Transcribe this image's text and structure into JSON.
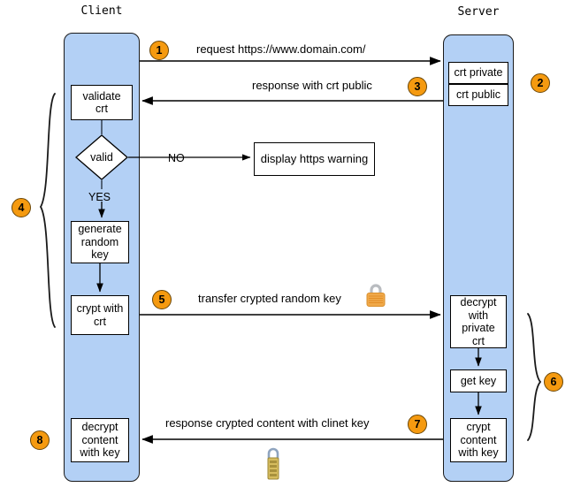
{
  "diagram": {
    "title_client": "Client",
    "title_server": "Server"
  },
  "client": {
    "steps": [
      {
        "id": "validate-crt",
        "label": "validate\ncrt"
      },
      {
        "id": "valid-decision",
        "label": "valid"
      },
      {
        "id": "generate-random-key",
        "label": "generate\nrandom\nkey"
      },
      {
        "id": "crypt-with-crt",
        "label": "crypt with\ncrt"
      },
      {
        "id": "decrypt-content-with-key",
        "label": "decrypt\ncontent\nwith key"
      }
    ],
    "yes_label": "YES",
    "no_label": "NO",
    "warning_box": "display https warning"
  },
  "server": {
    "certs": [
      {
        "id": "crt-private",
        "label": "crt private"
      },
      {
        "id": "crt-public",
        "label": "crt public"
      }
    ],
    "steps": [
      {
        "id": "decrypt-with-private-crt",
        "label": "decrypt\nwith\nprivate\ncrt"
      },
      {
        "id": "get-key",
        "label": "get key"
      },
      {
        "id": "crypt-content-with-key",
        "label": "crypt\ncontent\nwith key"
      }
    ]
  },
  "messages": [
    {
      "id": "m1",
      "label": "request https://www.domain.com/"
    },
    {
      "id": "m3",
      "label": "response with crt public"
    },
    {
      "id": "m5",
      "label": "transfer crypted random key"
    },
    {
      "id": "m7",
      "label": "response crypted content with clinet key"
    }
  ],
  "markers": [
    {
      "id": "marker-1",
      "label": "1"
    },
    {
      "id": "marker-2",
      "label": "2"
    },
    {
      "id": "marker-3",
      "label": "3"
    },
    {
      "id": "marker-4",
      "label": "4"
    },
    {
      "id": "marker-5",
      "label": "5"
    },
    {
      "id": "marker-6",
      "label": "6"
    },
    {
      "id": "marker-7",
      "label": "7"
    },
    {
      "id": "marker-8",
      "label": "8"
    }
  ],
  "icons": {
    "lock_transfer": "padlock-icon",
    "lock_response": "combination-padlock-icon"
  },
  "colors": {
    "lane_fill": "#b3d0f5",
    "marker_fill": "#f59a10",
    "stroke": "#000000",
    "lock_body": "#e8a33d"
  }
}
